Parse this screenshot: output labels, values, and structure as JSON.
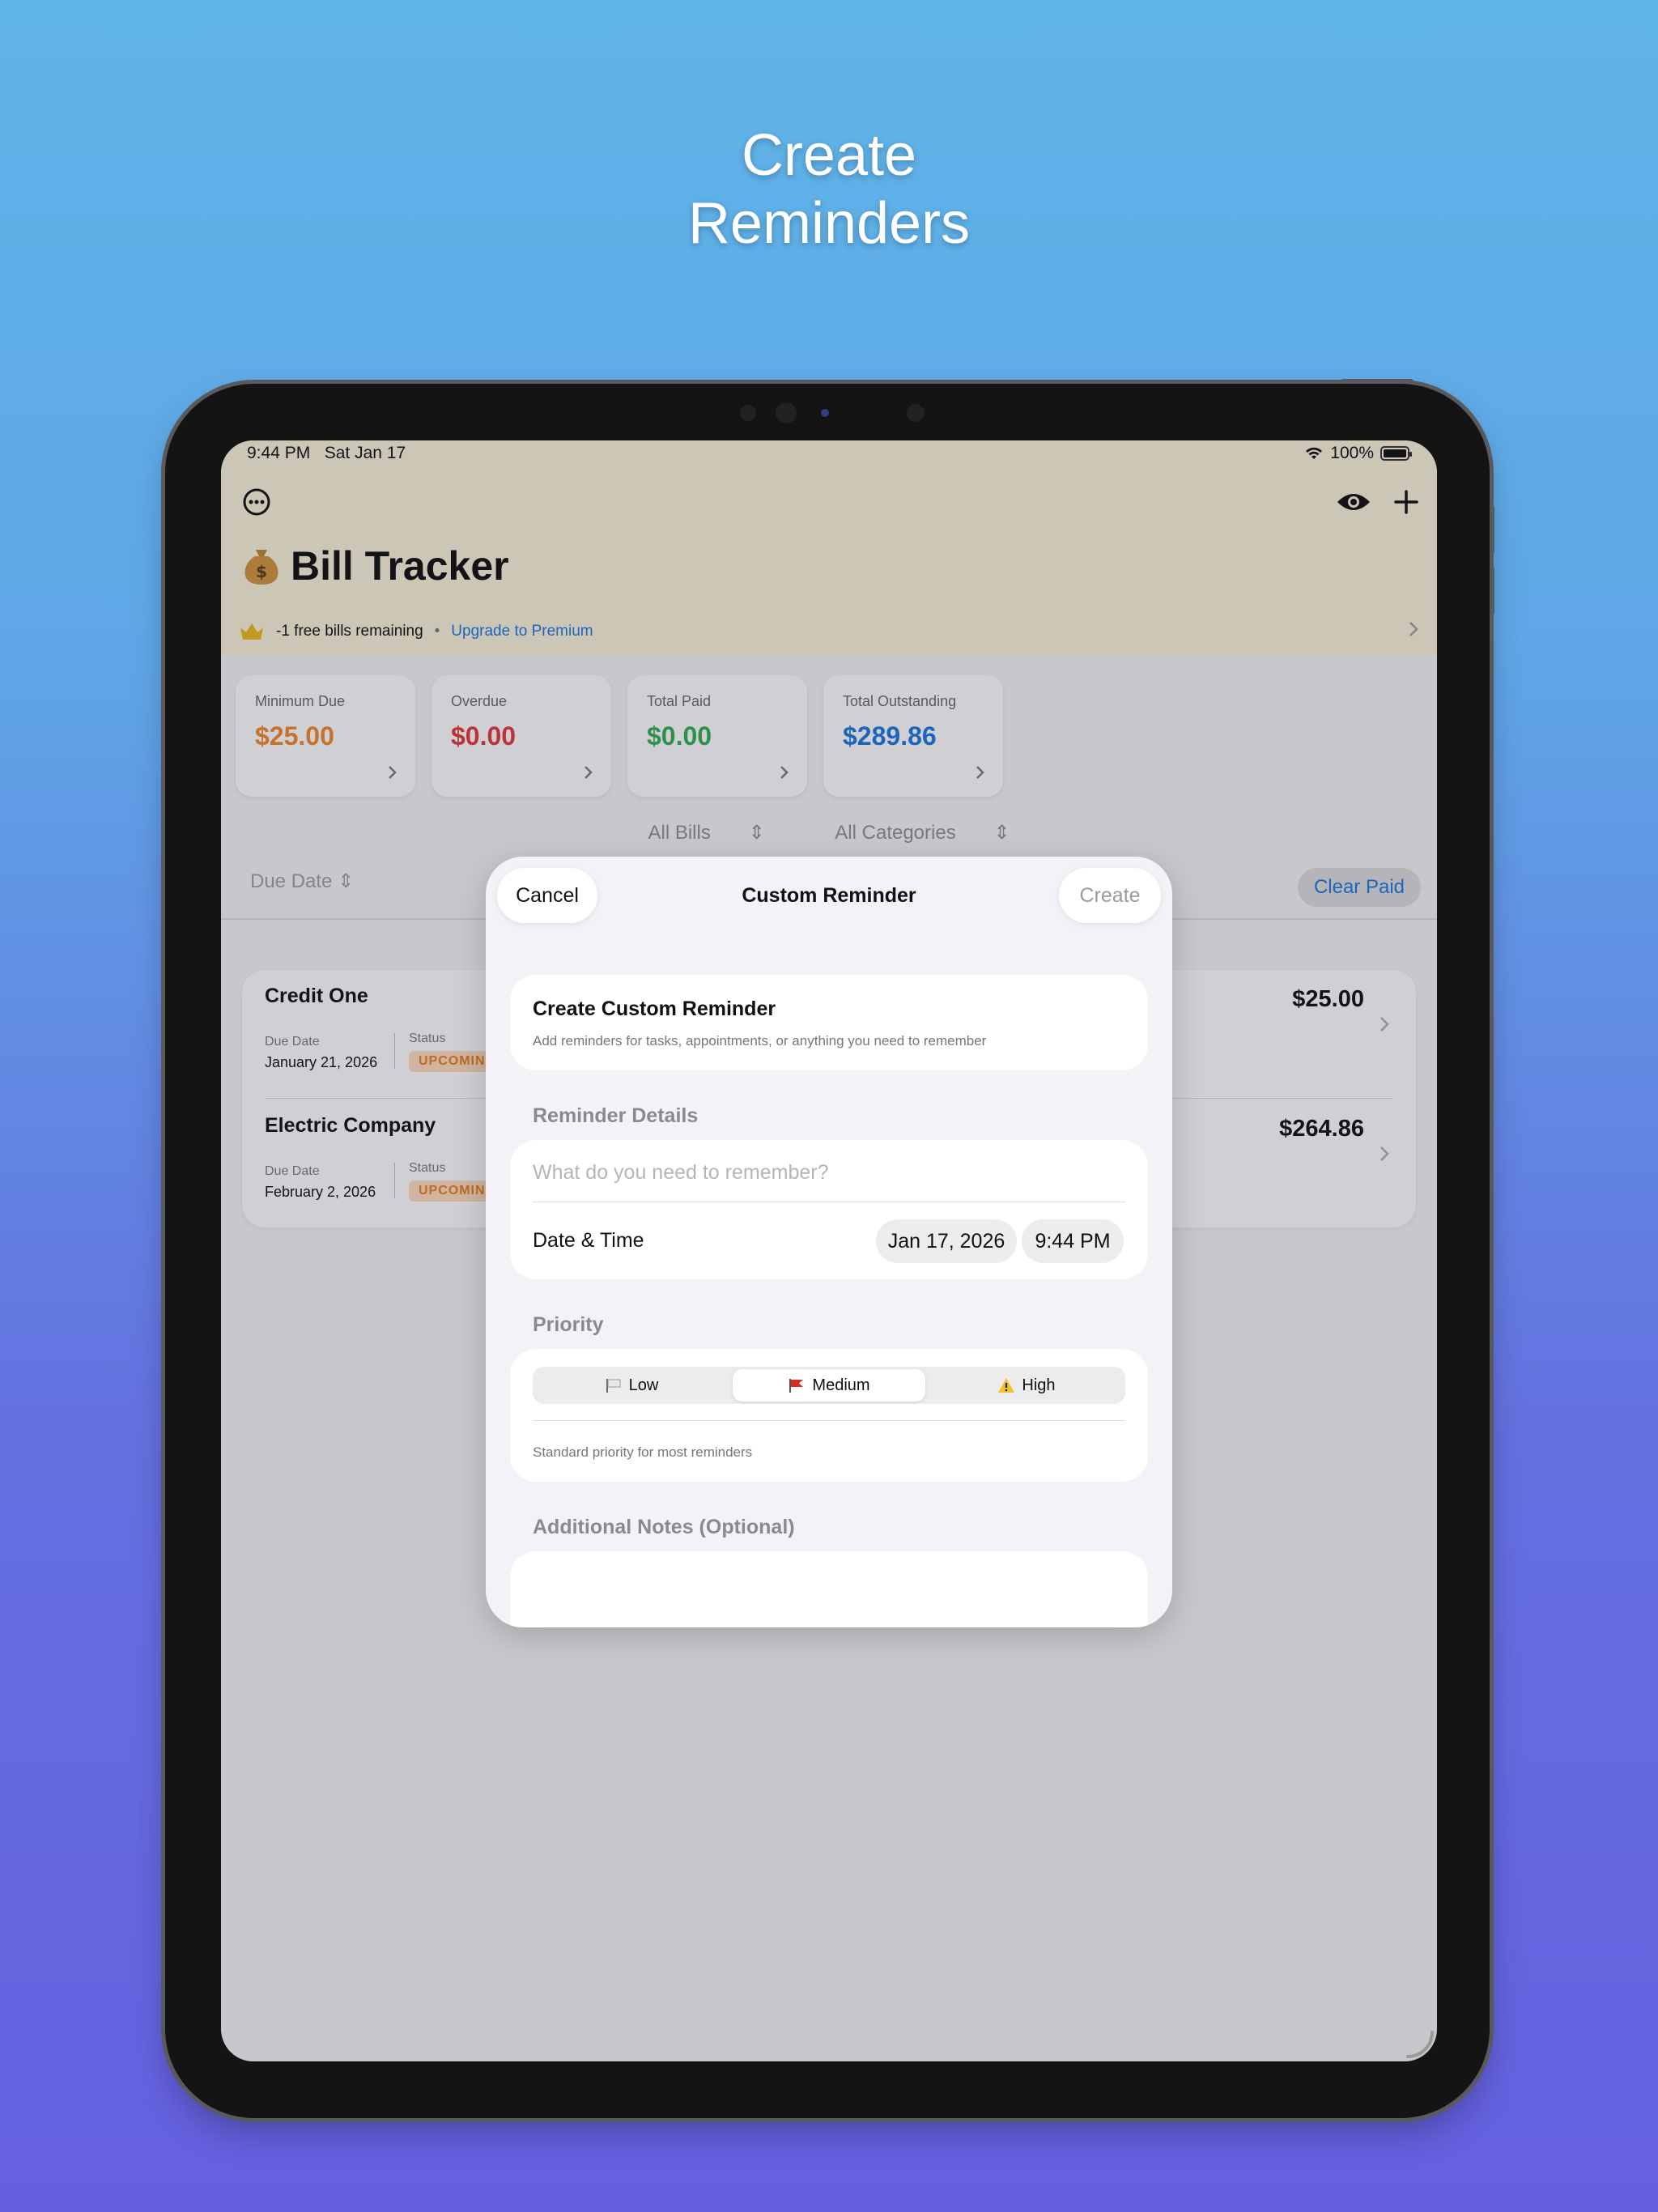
{
  "headline": {
    "line1": "Create",
    "line2": "Reminders"
  },
  "status_bar": {
    "time": "9:44 PM",
    "date": "Sat Jan 17",
    "battery": "100%"
  },
  "header": {
    "app_title": "Bill Tracker",
    "free_bills_text": "-1 free bills remaining",
    "separator": "•",
    "upgrade_link": "Upgrade to Premium"
  },
  "summary_cards": [
    {
      "label": "Minimum Due",
      "value": "$25.00",
      "color": "#e8832a"
    },
    {
      "label": "Overdue",
      "value": "$0.00",
      "color": "#d93636"
    },
    {
      "label": "Total Paid",
      "value": "$0.00",
      "color": "#2fa84f"
    },
    {
      "label": "Total Outstanding",
      "value": "$289.86",
      "color": "#1a73d9"
    }
  ],
  "filters": {
    "bills": "All Bills",
    "categories": "All Categories",
    "sort": "Due Date",
    "clear_paid": "Clear Paid"
  },
  "bills": [
    {
      "name": "Credit One",
      "due_label": "Due Date",
      "due_date": "January 21, 2026",
      "status_label": "Status",
      "status": "UPCOMIN",
      "amount": "$25.00"
    },
    {
      "name": "Electric Company",
      "due_label": "Due Date",
      "due_date": "February 2, 2026",
      "status_label": "Status",
      "status": "UPCOMIN",
      "amount": "$264.86"
    }
  ],
  "modal": {
    "cancel": "Cancel",
    "title": "Custom Reminder",
    "create": "Create",
    "intro_title": "Create Custom Reminder",
    "intro_subtitle": "Add reminders for tasks, appointments, or anything you need to remember",
    "details_label": "Reminder Details",
    "reminder_placeholder": "What do you need to remember?",
    "datetime_label": "Date & Time",
    "date_value": "Jan 17, 2026",
    "time_value": "9:44 PM",
    "priority_label": "Priority",
    "priorities": [
      {
        "label": "Low",
        "selected": false
      },
      {
        "label": "Medium",
        "selected": true
      },
      {
        "label": "High",
        "selected": false
      }
    ],
    "priority_description": "Standard priority for most reminders",
    "notes_label": "Additional Notes (Optional)"
  }
}
